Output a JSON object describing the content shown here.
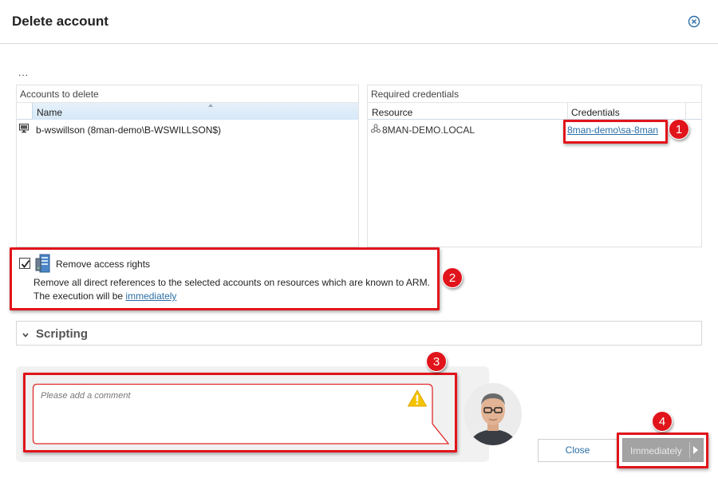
{
  "dialog": {
    "title": "Delete account",
    "ellipsis": "..."
  },
  "accounts_panel": {
    "caption": "Accounts to delete",
    "column_name": "Name",
    "rows": [
      {
        "icon": "monitor-icon",
        "name": "b-wswillson (8man-demo\\B-WSWILLSON$)"
      }
    ]
  },
  "credentials_panel": {
    "caption": "Required credentials",
    "column_resource": "Resource",
    "column_credentials": "Credentials",
    "rows": [
      {
        "icon": "network-icon",
        "resource": "8MAN-DEMO.LOCAL",
        "credentials": "8man-demo\\sa-8man"
      }
    ]
  },
  "remove_access": {
    "checked": true,
    "label": "Remove access rights",
    "description": "Remove all direct references to the selected accounts on resources which are known to ARM.",
    "execution_prefix": "The execution will be ",
    "execution_link": "immediately"
  },
  "scripting": {
    "label": "Scripting",
    "expanded": false
  },
  "comment": {
    "placeholder": "Please add a comment",
    "value": ""
  },
  "buttons": {
    "close": "Close",
    "immediately": "Immediately"
  },
  "callouts": [
    "1",
    "2",
    "3",
    "4"
  ],
  "colors": {
    "callout_red": "#e1141b",
    "link_blue": "#2a6ea6",
    "button_disabled_gray": "#a3a3a3",
    "header_highlight": "#d6e8f7"
  }
}
